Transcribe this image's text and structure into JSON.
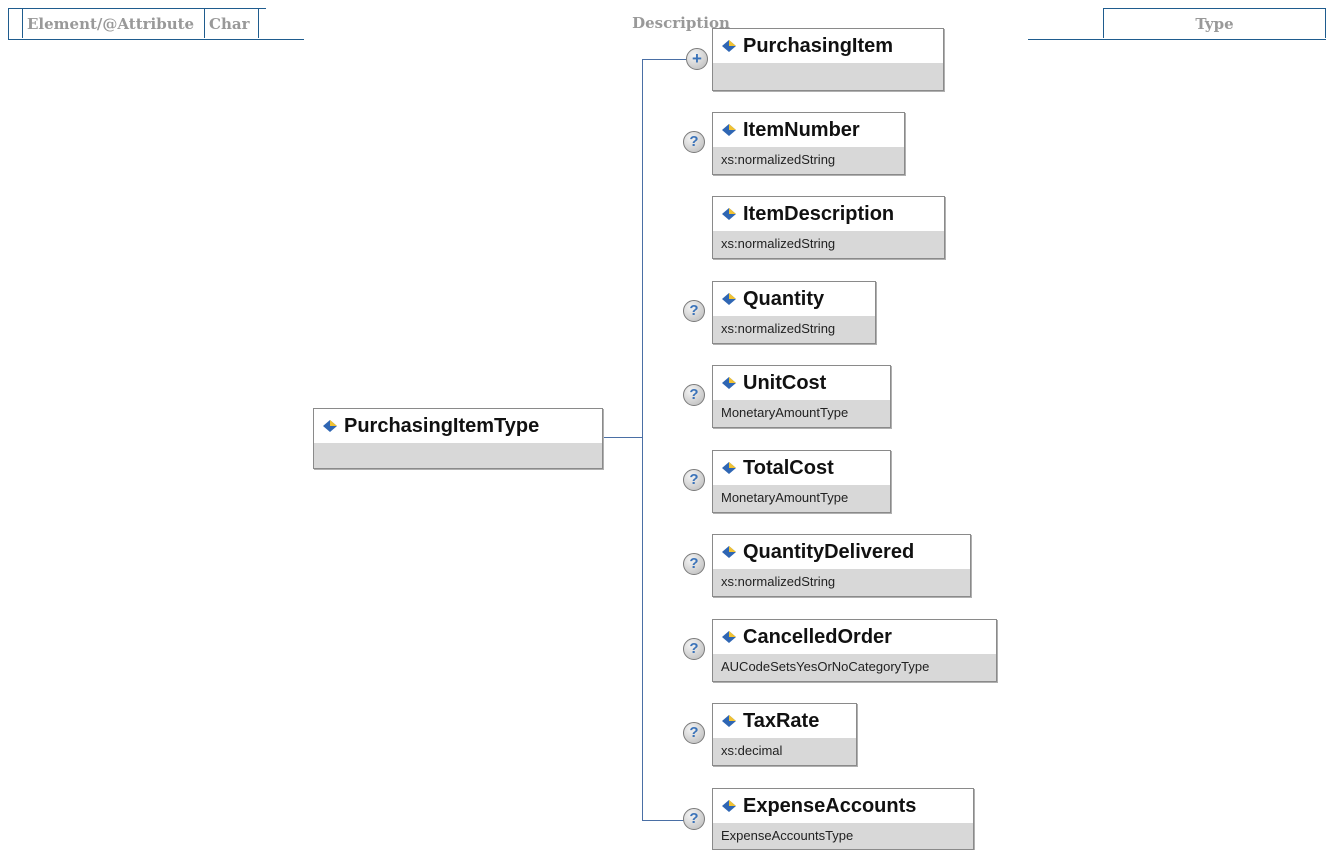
{
  "header": {
    "columns": [
      {
        "label": ""
      },
      {
        "label": "Element/@Attribute"
      },
      {
        "label": "Char"
      },
      {
        "label": "Description"
      },
      {
        "label": "Type"
      }
    ]
  },
  "diagram": {
    "root": {
      "name": "PurchasingItemType"
    },
    "children": [
      {
        "name": "PurchasingItem",
        "type": "",
        "badge": "+"
      },
      {
        "name": "ItemNumber",
        "type": "xs:normalizedString",
        "badge": "?"
      },
      {
        "name": "ItemDescription",
        "type": "xs:normalizedString",
        "badge": ""
      },
      {
        "name": "Quantity",
        "type": "xs:normalizedString",
        "badge": "?"
      },
      {
        "name": "UnitCost",
        "type": "MonetaryAmountType",
        "badge": "?"
      },
      {
        "name": "TotalCost",
        "type": "MonetaryAmountType",
        "badge": "?"
      },
      {
        "name": "QuantityDelivered",
        "type": "xs:normalizedString",
        "badge": "?"
      },
      {
        "name": "CancelledOrder",
        "type": "AUCodeSetsYesOrNoCategoryType",
        "badge": "?"
      },
      {
        "name": "TaxRate",
        "type": "xs:decimal",
        "badge": "?"
      },
      {
        "name": "ExpenseAccounts",
        "type": "ExpenseAccountsType",
        "badge": "?"
      }
    ]
  },
  "colors": {
    "wire": "#4a6fa5",
    "header_border": "#1f5c8e",
    "header_text": "#999999",
    "type_band": "#d8d8d8"
  }
}
